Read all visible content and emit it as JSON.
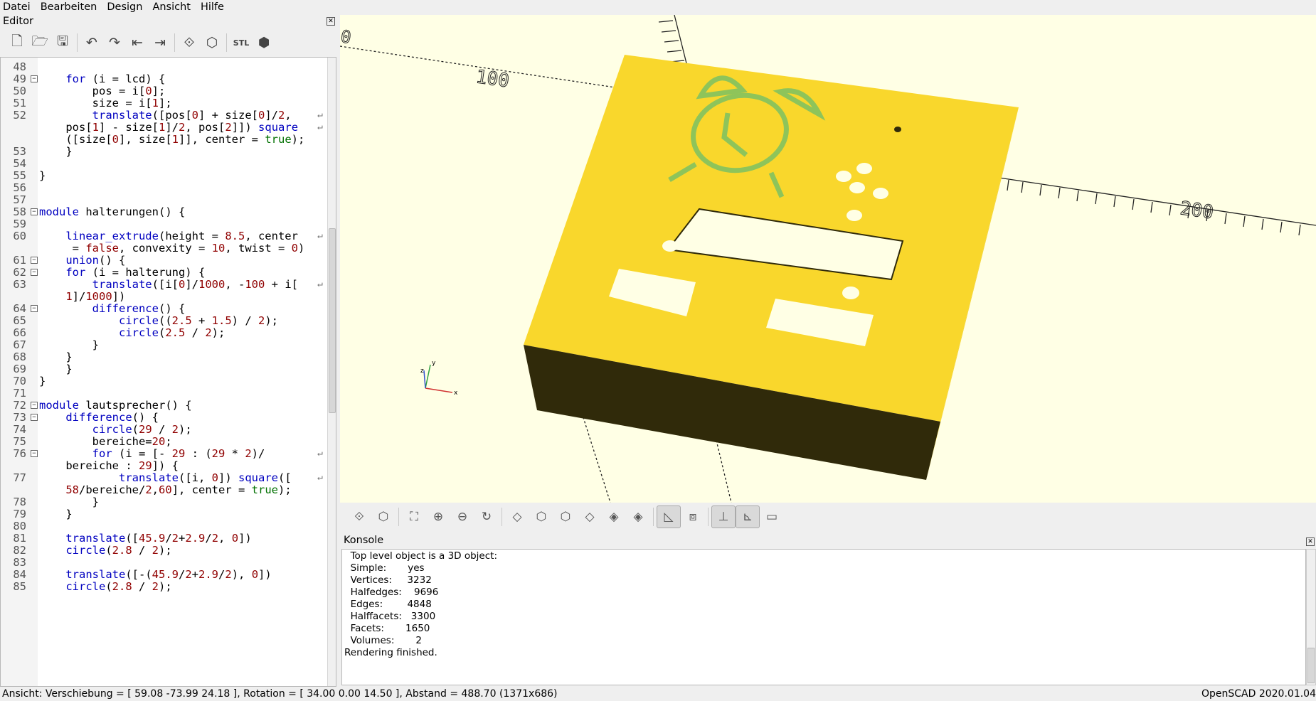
{
  "menubar": {
    "items": [
      "Datei",
      "Bearbeiten",
      "Design",
      "Ansicht",
      "Hilfe"
    ]
  },
  "editor": {
    "title": "Editor",
    "toolbar_icons": [
      "new-file-icon",
      "open-file-icon",
      "save-icon",
      "undo-icon",
      "redo-icon",
      "unindent-icon",
      "indent-icon",
      "preview-icon",
      "render-icon",
      "export-stl-icon",
      "send-to-3d-print-icon"
    ],
    "lines": [
      {
        "n": "48",
        "fold": false,
        "t": ""
      },
      {
        "n": "49",
        "fold": true,
        "t": "    <span class=kw>for</span> (i = lcd) {"
      },
      {
        "n": "50",
        "fold": false,
        "t": "        pos = i[<span class=num>0</span>];"
      },
      {
        "n": "51",
        "fold": false,
        "t": "        size = i[<span class=num>1</span>];"
      },
      {
        "n": "52",
        "fold": false,
        "t": "        <span class=fn>translate</span>([pos[<span class=num>0</span>] + size[<span class=num>0</span>]/<span class=num>2</span>,",
        "wrap": true
      },
      {
        "n": "",
        "fold": false,
        "t": "    pos[<span class=num>1</span>] - size[<span class=num>1</span>]/<span class=num>2</span>, pos[<span class=num>2</span>]]) <span class=fn>square</span>",
        "wrap": true
      },
      {
        "n": "",
        "fold": false,
        "t": "    ([size[<span class=num>0</span>], size[<span class=num>1</span>]], center = <span class=mod>true</span>);"
      },
      {
        "n": "53",
        "fold": false,
        "t": "    }"
      },
      {
        "n": "54",
        "fold": false,
        "t": ""
      },
      {
        "n": "55",
        "fold": false,
        "t": "}"
      },
      {
        "n": "56",
        "fold": false,
        "t": ""
      },
      {
        "n": "57",
        "fold": false,
        "t": ""
      },
      {
        "n": "58",
        "fold": true,
        "t": "<span class=kw>module</span> halterungen() {"
      },
      {
        "n": "59",
        "fold": false,
        "t": ""
      },
      {
        "n": "60",
        "fold": false,
        "t": "    <span class=fn>linear_extrude</span>(height = <span class=num>8.5</span>, center",
        "wrap": true
      },
      {
        "n": "",
        "fold": false,
        "t": "     = <span class=num>false</span>, convexity = <span class=num>10</span>, twist = <span class=num>0</span>)"
      },
      {
        "n": "61",
        "fold": true,
        "t": "    <span class=fn>union</span>() {"
      },
      {
        "n": "62",
        "fold": true,
        "t": "    <span class=kw>for</span> (i = halterung) {"
      },
      {
        "n": "63",
        "fold": false,
        "t": "        <span class=fn>translate</span>([i[<span class=num>0</span>]/<span class=num>1000</span>, -<span class=num>100</span> + i[",
        "wrap": true
      },
      {
        "n": "",
        "fold": false,
        "t": "    <span class=num>1</span>]/<span class=num>1000</span>])"
      },
      {
        "n": "64",
        "fold": true,
        "t": "        <span class=fn>difference</span>() {"
      },
      {
        "n": "65",
        "fold": false,
        "t": "            <span class=fn>circle</span>((<span class=num>2.5</span> + <span class=num>1.5</span>) / <span class=num>2</span>);"
      },
      {
        "n": "66",
        "fold": false,
        "t": "            <span class=fn>circle</span>(<span class=num>2.5</span> / <span class=num>2</span>);"
      },
      {
        "n": "67",
        "fold": false,
        "t": "        }"
      },
      {
        "n": "68",
        "fold": false,
        "t": "    }"
      },
      {
        "n": "69",
        "fold": false,
        "t": "    }"
      },
      {
        "n": "70",
        "fold": false,
        "t": "}"
      },
      {
        "n": "71",
        "fold": false,
        "t": ""
      },
      {
        "n": "72",
        "fold": true,
        "t": "<span class=kw>module</span> lautsprecher() {"
      },
      {
        "n": "73",
        "fold": true,
        "t": "    <span class=fn>difference</span>() {"
      },
      {
        "n": "74",
        "fold": false,
        "t": "        <span class=fn>circle</span>(<span class=num>29</span> / <span class=num>2</span>);"
      },
      {
        "n": "75",
        "fold": false,
        "t": "        bereiche=<span class=num>20</span>;"
      },
      {
        "n": "76",
        "fold": true,
        "t": "        <span class=kw>for</span> (i = [- <span class=num>29</span> : (<span class=num>29</span> * <span class=num>2</span>)/",
        "wrap": true
      },
      {
        "n": "",
        "fold": false,
        "t": "    bereiche : <span class=num>29</span>]) {"
      },
      {
        "n": "77",
        "fold": false,
        "t": "            <span class=fn>translate</span>([i, <span class=num>0</span>]) <span class=fn>square</span>([",
        "wrap": true
      },
      {
        "n": "",
        "fold": false,
        "t": "    <span class=num>58</span>/bereiche/<span class=num>2</span>,<span class=num>60</span>], center = <span class=mod>true</span>);"
      },
      {
        "n": "78",
        "fold": false,
        "t": "        }"
      },
      {
        "n": "79",
        "fold": false,
        "t": "    }"
      },
      {
        "n": "80",
        "fold": false,
        "t": ""
      },
      {
        "n": "81",
        "fold": false,
        "t": "    <span class=fn>translate</span>([<span class=num>45.9</span>/<span class=num>2</span>+<span class=num>2.9</span>/<span class=num>2</span>, <span class=num>0</span>])"
      },
      {
        "n": "82",
        "fold": false,
        "t": "    <span class=fn>circle</span>(<span class=num>2.8</span> / <span class=num>2</span>);"
      },
      {
        "n": "83",
        "fold": false,
        "t": ""
      },
      {
        "n": "84",
        "fold": false,
        "t": "    <span class=fn>translate</span>([-(<span class=num>45.9</span>/<span class=num>2</span>+<span class=num>2.9</span>/<span class=num>2</span>), <span class=num>0</span>])"
      },
      {
        "n": "85",
        "fold": false,
        "t": "    <span class=fn>circle</span>(<span class=num>2.8</span> / <span class=num>2</span>);"
      }
    ]
  },
  "viewport": {
    "axis_labels": [
      "100",
      "200",
      "0"
    ],
    "colors": {
      "background": "#ffffe5",
      "top_face": "#f9d72c",
      "side_face": "#302a0a",
      "cutout": "#ffffe5",
      "clock_green": "#8ec45a"
    }
  },
  "view_toolbar_icons": [
    "preview-icon",
    "render-icon",
    "zoom-all-icon",
    "zoom-in-icon",
    "zoom-out-icon",
    "reset-view-icon",
    "view-right-icon",
    "view-top-icon",
    "view-bottom-icon",
    "view-left-icon",
    "view-front-icon",
    "view-back-icon",
    "perspective-icon",
    "orthogonal-icon",
    "show-axes-icon",
    "show-scale-markers-icon",
    "show-edges-icon"
  ],
  "console": {
    "title": "Konsole",
    "lines": [
      "  Top level object is a 3D object:",
      "  Simple:       yes",
      "  Vertices:     3232",
      "  Halfedges:    9696",
      "  Edges:        4848",
      "  Halffacets:   3300",
      "  Facets:       1650",
      "  Volumes:       2",
      "Rendering finished."
    ]
  },
  "status": {
    "left": "Ansicht: Verschiebung = [ 59.08 -73.99 24.18 ], Rotation = [ 34.00 0.00 14.50 ], Abstand = 488.70 (1371x686)",
    "right": "OpenSCAD 2020.01.04"
  }
}
